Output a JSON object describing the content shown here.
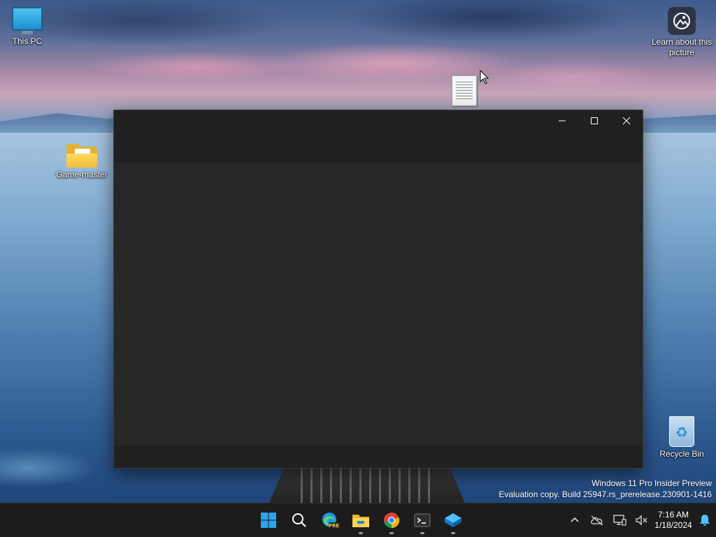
{
  "desktop": {
    "icons": [
      {
        "label": "This PC"
      },
      {
        "label": "Game-master"
      },
      {
        "label": "Learn about this picture"
      },
      {
        "label": "Recycle Bin"
      }
    ]
  },
  "watermark": {
    "line1": "Windows 11 Pro Insider Preview",
    "line2": "Evaluation copy. Build 25947.rs_prerelease.230901-1416"
  },
  "window": {
    "controls": [
      "minimize-icon",
      "maximize-icon",
      "close-icon"
    ]
  },
  "taskbar": {
    "apps": [
      "start-icon",
      "search-icon",
      "edge-icon",
      "file-explorer-icon",
      "chrome-icon",
      "terminal-icon",
      "app-icon"
    ],
    "edge_badge": "PRE",
    "clock": {
      "time": "7:16 AM",
      "date": "1/18/2024"
    }
  },
  "colors": {
    "window_bg": "#272727",
    "titlebar_bg": "#202020",
    "taskbar_bg": "#1c1c1c",
    "accent": "#0078d4"
  }
}
